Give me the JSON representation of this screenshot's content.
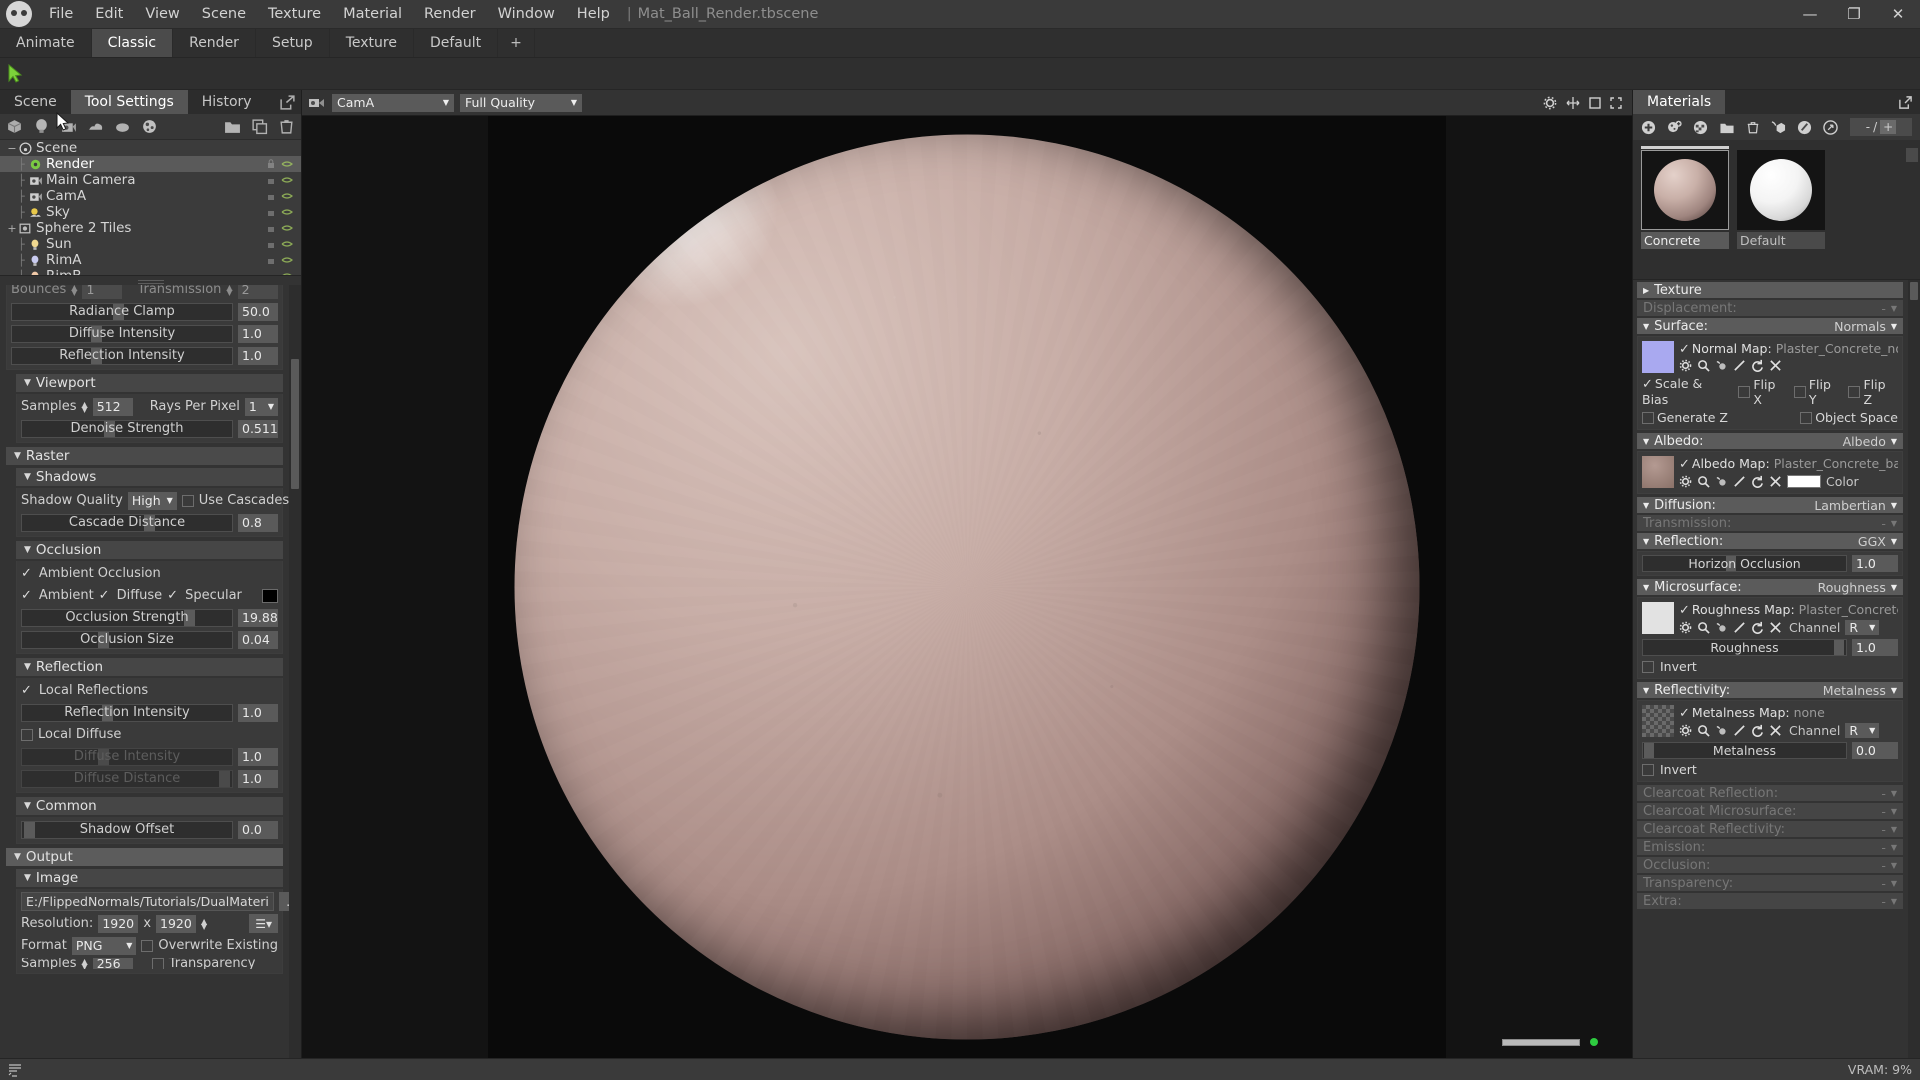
{
  "app": {
    "title": "Mat_Ball_Render.tbscene",
    "menu": [
      "File",
      "Edit",
      "View",
      "Scene",
      "Texture",
      "Material",
      "Render",
      "Window",
      "Help"
    ],
    "separator": "|",
    "window_buttons": {
      "minimize": "—",
      "maximize": "❐",
      "close": "✕"
    }
  },
  "layout_tabs": {
    "items": [
      "Animate",
      "Classic",
      "Render",
      "Setup",
      "Texture",
      "Default"
    ],
    "active": "Classic",
    "add_label": "+"
  },
  "left_panel": {
    "tabs": [
      "Scene",
      "Tool Settings",
      "History"
    ],
    "active_tab": "Tool Settings",
    "outliner": [
      {
        "label": "Scene",
        "indent": 0,
        "expander": "−",
        "icon": "scene-icon"
      },
      {
        "label": "Render",
        "indent": 1,
        "expander": "",
        "icon": "gear-icon",
        "selected": true
      },
      {
        "label": "Main Camera",
        "indent": 1,
        "expander": "",
        "icon": "camera-icon"
      },
      {
        "label": "CamA",
        "indent": 1,
        "expander": "",
        "icon": "camera-icon"
      },
      {
        "label": "Sky",
        "indent": 1,
        "expander": "",
        "icon": "sky-icon"
      },
      {
        "label": "Sphere 2 Tiles",
        "indent": 1,
        "expander": "+",
        "icon": "mesh-icon"
      },
      {
        "label": "Sun",
        "indent": 1,
        "expander": "",
        "icon": "light-icon"
      },
      {
        "label": "RimA",
        "indent": 1,
        "expander": "",
        "icon": "light-icon"
      },
      {
        "label": "RimB",
        "indent": 1,
        "expander": "",
        "icon": "light-icon"
      }
    ],
    "raytrace": {
      "bounces_label": "Bounces",
      "bounces_value": "1",
      "transmission_label": "Transmission",
      "transmission_value": "2",
      "radiance_clamp_label": "Radiance Clamp",
      "radiance_clamp_value": "50.0",
      "diffuse_intensity_label": "Diffuse Intensity",
      "diffuse_intensity_value": "1.0",
      "reflection_intensity_label": "Reflection Intensity",
      "reflection_intensity_value": "1.0"
    },
    "viewport": {
      "title": "Viewport",
      "samples_label": "Samples",
      "samples_value": "512",
      "rays_label": "Rays Per Pixel",
      "rays_value": "1",
      "denoise_label": "Denoise Strength",
      "denoise_value": "0.511"
    },
    "raster": {
      "title": "Raster",
      "shadows_title": "Shadows",
      "shadow_quality_label": "Shadow Quality",
      "shadow_quality_value": "High",
      "use_cascades_label": "Use Cascades",
      "cascade_distance_label": "Cascade Distance",
      "cascade_distance_value": "0.8"
    },
    "occlusion": {
      "title": "Occlusion",
      "ambient_occlusion_label": "Ambient Occlusion",
      "ambient_label": "Ambient",
      "diffuse_label": "Diffuse",
      "specular_label": "Specular",
      "strength_label": "Occlusion Strength",
      "strength_value": "19.88",
      "size_label": "Occlusion Size",
      "size_value": "0.04",
      "color": "#000000"
    },
    "reflection": {
      "title": "Reflection",
      "local_reflections_label": "Local Reflections",
      "reflection_intensity_label": "Reflection Intensity",
      "reflection_intensity_value": "1.0",
      "local_diffuse_label": "Local Diffuse",
      "diffuse_intensity_label": "Diffuse Intensity",
      "diffuse_intensity_value": "1.0",
      "diffuse_distance_label": "Diffuse Distance",
      "diffuse_distance_value": "1.0"
    },
    "common": {
      "title": "Common",
      "shadow_offset_label": "Shadow Offset",
      "shadow_offset_value": "0.0"
    },
    "output": {
      "title": "Output",
      "image_title": "Image",
      "path_value": "E:/FlippedNormals/Tutorials/DualMateri",
      "browse_label": "...",
      "resolution_label": "Resolution:",
      "res_width": "1920",
      "res_height": "1920",
      "res_x": "x",
      "preset_label": "☰▾",
      "format_label": "Format",
      "format_value": "PNG",
      "overwrite_label": "Overwrite Existing",
      "samples_label": "Samples",
      "samples_value": "256",
      "transparency_label": "Transparency"
    }
  },
  "viewport_bar": {
    "camera_value": "CamA",
    "quality_value": "Full Quality",
    "icons": [
      "gear-icon",
      "move-icon",
      "resize-icon",
      "fullscreen-icon"
    ]
  },
  "right_panel": {
    "tab_label": "Materials",
    "expand_icon": "popout-icon",
    "toolbar_icons": [
      "add-material-icon",
      "duplicate-material-icon",
      "clear-material-icon",
      "folder-icon",
      "trash-icon",
      "assign-icon",
      "edit-icon",
      "pick-icon"
    ],
    "count_left": "-",
    "count_sep": "/",
    "count_right": "+",
    "materials": [
      {
        "name": "Concrete",
        "selected": true,
        "color": "#b99e99"
      },
      {
        "name": "Default",
        "selected": false,
        "color": "#f2f2f2"
      }
    ],
    "properties": [
      {
        "name": "Texture",
        "value": "",
        "type": "collapsed",
        "enabled": true
      },
      {
        "name": "Displacement:",
        "value": "-",
        "type": "header",
        "enabled": false
      },
      {
        "name": "Surface:",
        "value": "Normals",
        "type": "header",
        "enabled": true
      }
    ],
    "surface": {
      "label": "Surface:",
      "value": "Normals",
      "map_label": "Normal Map:",
      "map_file": "Plaster_Concrete_normal.t",
      "thumb_color": "#a9a9f0",
      "scale_bias": "Scale & Bias",
      "flip_x": "Flip X",
      "flip_y": "Flip Y",
      "flip_z": "Flip Z",
      "generate_z": "Generate Z",
      "object_space": "Object Space"
    },
    "albedo": {
      "label": "Albedo:",
      "value": "Albedo",
      "map_label": "Albedo Map:",
      "map_file": "Plaster_Concrete_basecolo",
      "color_label": "Color",
      "color_value": "#ffffff"
    },
    "diffusion": {
      "label": "Diffusion:",
      "value": "Lambertian"
    },
    "transmission": {
      "label": "Transmission:",
      "value": "-"
    },
    "reflection": {
      "label": "Reflection:",
      "value": "GGX",
      "horizon_label": "Horizon Occlusion",
      "horizon_value": "1.0"
    },
    "microsurface": {
      "label": "Microsurface:",
      "value": "Roughness",
      "map_label": "Roughness Map:",
      "map_file": "Plaster_Concrete_rough",
      "channel_label": "Channel",
      "channel_value": "R",
      "slider_label": "Roughness",
      "slider_value": "1.0",
      "invert_label": "Invert"
    },
    "reflectivity": {
      "label": "Reflectivity:",
      "value": "Metalness",
      "map_label": "Metalness Map:",
      "map_file": "none",
      "channel_label": "Channel",
      "channel_value": "R",
      "slider_label": "Metalness",
      "slider_value": "0.0",
      "invert_label": "Invert"
    },
    "disabled_sections": [
      {
        "label": "Clearcoat Reflection:",
        "value": "-"
      },
      {
        "label": "Clearcoat Microsurface:",
        "value": "-"
      },
      {
        "label": "Clearcoat Reflectivity:",
        "value": "-"
      },
      {
        "label": "Emission:",
        "value": "-"
      },
      {
        "label": "Occlusion:",
        "value": "-"
      },
      {
        "label": "Transparency:",
        "value": "-"
      },
      {
        "label": "Extra:",
        "value": "-"
      }
    ]
  },
  "statusbar": {
    "console_icon": "console-icon",
    "vram_label": "VRAM: 9%"
  }
}
